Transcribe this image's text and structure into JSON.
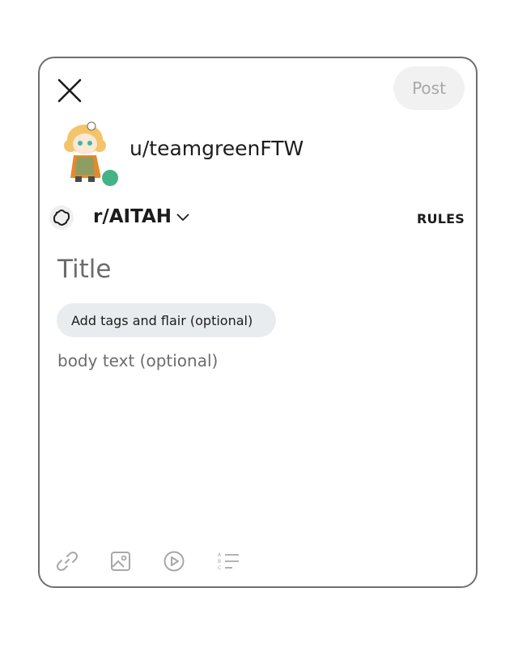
{
  "composer": {
    "post_label": "Post",
    "username": "u/teamgreenFTW",
    "subreddit": "r/AITAH",
    "rules_label": "RULES",
    "title_placeholder": "Title",
    "tags_label": "Add tags and flair (optional)",
    "body_placeholder": "body text (optional)"
  },
  "icons": {
    "close": "close-icon",
    "subreddit": "subreddit-icon",
    "chevron": "chevron-down-icon",
    "toolbar": [
      "link-icon",
      "image-icon",
      "video-icon",
      "poll-icon"
    ]
  },
  "colors": {
    "online": "#46b386",
    "placeholder": "#6c6c6c",
    "post_button_bg": "#f1f1f1",
    "tag_bg": "#e9ecef"
  }
}
